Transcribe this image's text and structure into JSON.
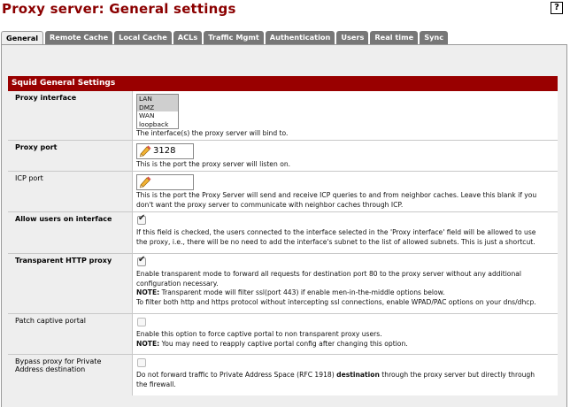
{
  "page": {
    "title": "Proxy server: General settings",
    "help_icon": "?"
  },
  "tabs": [
    {
      "label": "General",
      "active": true
    },
    {
      "label": "Remote Cache"
    },
    {
      "label": "Local Cache"
    },
    {
      "label": "ACLs"
    },
    {
      "label": "Traffic Mgmt"
    },
    {
      "label": "Authentication"
    },
    {
      "label": "Users"
    },
    {
      "label": "Real time"
    },
    {
      "label": "Sync"
    }
  ],
  "section": {
    "title": "Squid General Settings"
  },
  "proxy_interface": {
    "label": "Proxy interface",
    "options": [
      "LAN",
      "DMZ",
      "WAN",
      "loopback"
    ],
    "selected": [
      "LAN",
      "DMZ"
    ],
    "description": "The interface(s) the proxy server will bind to."
  },
  "proxy_port": {
    "label": "Proxy port",
    "value": "3128",
    "description": "This is the port the proxy server will listen on."
  },
  "icp_port": {
    "label": "ICP port",
    "value": "",
    "description_1": "This is the port the Proxy Server will send and receive ICP queries to and from neighbor caches. Leave this blank if you",
    "description_2": "don't want the proxy server to communicate with neighbor caches through ICP."
  },
  "allow_users": {
    "label": "Allow users on interface",
    "checked": true,
    "description_1": "If this field is checked, the users connected to the interface selected in the 'Proxy interface' field will be allowed to use",
    "description_2": "the proxy, i.e., there will be no need to add the interface's subnet to the list of allowed subnets. This is just a shortcut."
  },
  "transparent": {
    "label": "Transparent HTTP proxy",
    "checked": true,
    "description_1": "Enable transparent mode to forward all requests for destination port 80 to the proxy server without any additional",
    "description_2": "configuration necessary.",
    "note_label": "NOTE:",
    "note_text": " Transparent mode will filter ssl(port 443) if enable men-in-the-middle options below.",
    "description_3": "To filter both http and https protocol without intercepting ssl connections, enable WPAD/PAC options on your dns/dhcp."
  },
  "patch_captive": {
    "label": "Patch captive portal",
    "checked": false,
    "description_1": "Enable this option to force captive portal to non transparent proxy users.",
    "note_label": "NOTE:",
    "note_text": " You may need to reapply captive portal config after changing this option."
  },
  "bypass_private": {
    "label_1": "Bypass proxy for Private",
    "label_2": "Address destination",
    "checked": false,
    "description_pre": "Do not forward traffic to Private Address Space (RFC 1918) ",
    "description_bold": "destination",
    "description_post": " through the proxy server but directly through",
    "description_2": "the firewall."
  }
}
